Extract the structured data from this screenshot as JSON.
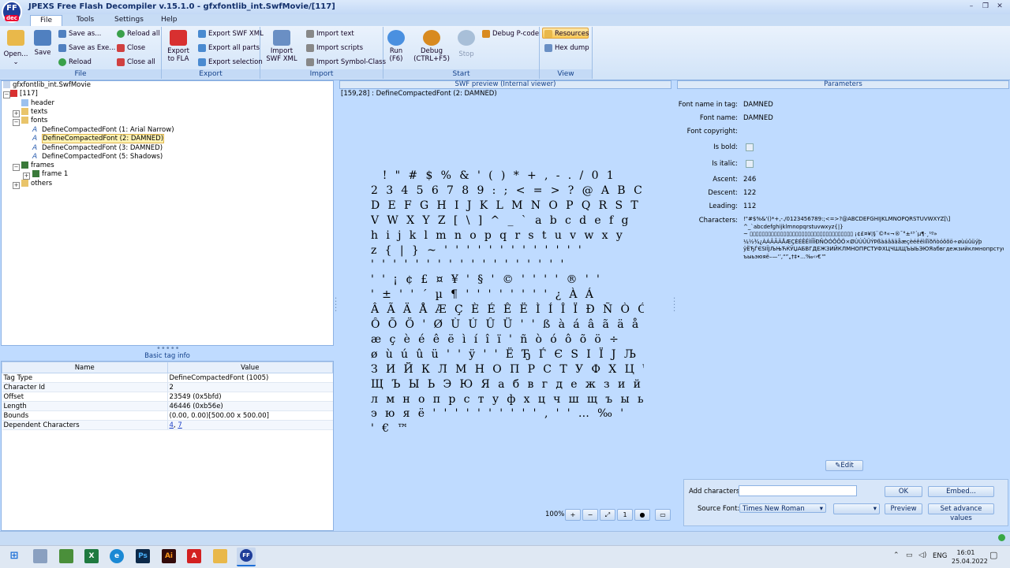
{
  "window": {
    "title": "JPEXS Free Flash Decompiler v.15.1.0 - gfxfontlib_int.SwfMovie/[117]",
    "logo_text": "FF",
    "logo_sub": "dec"
  },
  "menu": [
    "File",
    "Tools",
    "Settings",
    "Help"
  ],
  "ribbon": {
    "file": {
      "label": "File",
      "open": "Open...",
      "save": "Save",
      "save_as": "Save as...",
      "save_as_exe": "Save as Exe...",
      "reload": "Reload",
      "reload_all": "Reload all",
      "close": "Close",
      "close_all": "Close all"
    },
    "export": {
      "label": "Export",
      "export_fla_1": "Export",
      "export_fla_2": "to FLA",
      "export_swf_xml": "Export SWF XML",
      "export_all_parts": "Export all parts",
      "export_selection": "Export selection"
    },
    "import": {
      "label": "Import",
      "import_swf_xml_1": "Import",
      "import_swf_xml_2": "SWF XML",
      "import_text": "Import text",
      "import_scripts": "Import scripts",
      "import_symbol_class": "Import Symbol-Class"
    },
    "start": {
      "label": "Start",
      "run_1": "Run",
      "run_2": "(F6)",
      "debug_1": "Debug",
      "debug_2": "(CTRL+F5)",
      "stop": "Stop",
      "debug_pcode": "Debug P-code"
    },
    "view": {
      "label": "View",
      "resources": "Resources",
      "hex_dump": "Hex dump"
    }
  },
  "tree": {
    "root": "gfxfontlib_int.SwfMovie",
    "node_117": "[117]",
    "header": "header",
    "texts": "texts",
    "fonts": "fonts",
    "font1": "DefineCompactedFont (1: Arial Narrow)",
    "font2": "DefineCompactedFont (2: DAMNED)",
    "font3": "DefineCompactedFont (3: DAMNED)",
    "font5": "DefineCompactedFont (5: Shadows)",
    "frames": "frames",
    "frame1": "frame 1",
    "others": "others"
  },
  "tag_info": {
    "title": "Basic tag info",
    "col_name": "Name",
    "col_value": "Value",
    "rows": [
      {
        "name": "Tag Type",
        "value": "DefineCompactedFont (1005)"
      },
      {
        "name": "Character Id",
        "value": "2"
      },
      {
        "name": "Offset",
        "value": "23549 (0x5bfd)"
      },
      {
        "name": "Length",
        "value": "46446 (0xb56e)"
      },
      {
        "name": "Bounds",
        "value": "(0.00, 0.00)[500.00 x 500.00]"
      }
    ],
    "dependent_label": "Dependent Characters",
    "dependent_links": [
      "4",
      "7"
    ]
  },
  "preview": {
    "title": "SWF preview (Internal viewer)",
    "status": "[159,28] : DefineCompactedFont (2: DAMNED)",
    "zoom": "100%",
    "glyph_rows": [
      " !\"#$%&'()*+,-./01",
      "23456789:;<=>?@ABC",
      "DEFGHIJKLMNOPQRSTU",
      "VWXYZ[\\]^_`abcdefg",
      "hijklmnopqrstuvwxy",
      "z{|}~'''''''''''''",
      "''''''''''''''''''",
      "''¡¢£¤¥'§'©''''®''",
      "'±''´µ¶''''''''¿ÀÁ",
      "ÂÃÄÅÆÇÈÉÊËÌÍÎÏÐÑÒÓ",
      "ÔÕÖ'ØÙÚÛÜ''ßàáâãäå",
      "æçèéêëìíîï'ñòóôõö÷",
      "øùúûü''ÿ''ЁЂЃЄЅІЇЈЉЊ",
      "ЗИЙКЛМНОПРСТУФХЦЧШ",
      "ЩЪЫЬЭЮЯабвгдежзийк",
      "лмнопрстуфхцчшщъыь",
      "эюяё''''''''''‚''…‰'",
      "'€™"
    ]
  },
  "params": {
    "title": "Parameters",
    "font_name_in_tag_label": "Font name in tag:",
    "font_name_in_tag": "DAMNED",
    "font_name_label": "Font name:",
    "font_name": "DAMNED",
    "copyright_label": "Font copyright:",
    "is_bold_label": "Is bold:",
    "is_italic_label": "Is italic:",
    "ascent_label": "Ascent:",
    "ascent": "246",
    "descent_label": "Descent:",
    "descent": "122",
    "leading_label": "Leading:",
    "leading": "112",
    "characters_label": "Characters:",
    "characters_1": " !\"#$%&'()*+,-./0123456789:;<=>?@ABCDEFGHIJKLMNOPQRSTUVWXYZ[\\]",
    "characters_2": "^_`abcdefghijklmnopqrstuvwxyz{|}",
    "characters_3": "~ ▯▯▯▯▯▯▯▯▯▯▯▯▯▯▯▯▯▯▯▯▯▯▯▯▯▯▯▯▯▯▯▯▯▯ ¡¢£¤¥¦§¨©ª«¬­®¯°±²³´µ¶·¸¹º»",
    "characters_4": "¼½¾¿ÀÁÂÃÄÅÆÇÈÉÊËÌÍÎÏÐÑÒÓÔÕÖ×ØÙÚÛÜÝÞßàáâãäåæçèéêëìíîïðñòóôõö÷øùúûüýþ",
    "characters_5": "ÿЁЂЃЄЅІЇЈЉЊЋЌЎЏАБВГДЕЖЗИЙКЛМНОПРСТУФХЦЧШЩЪЫЬЭЮЯабвгдежзийклмнопрстуфхцчшщ",
    "characters_6": "ъыьэюяё–—‘’‚“”„†‡•…‰‹›€™",
    "edit": "Edit",
    "add_chars_label": "Add characters:",
    "ok": "OK",
    "embed": "Embed...",
    "source_font_label": "Source Font:",
    "source_font": "Times New Roman",
    "preview": "Preview",
    "set_advance": "Set advance values"
  },
  "taskbar": {
    "lang": "ENG",
    "time": "16:01",
    "date": "25.04.2022"
  }
}
